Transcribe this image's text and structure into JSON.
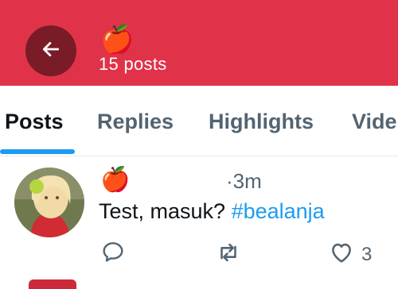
{
  "header": {
    "back_icon": "arrow-left-icon",
    "profile_emoji": "🍎",
    "post_count": "15 posts",
    "background": "#e0334a"
  },
  "tabs": [
    {
      "label": "Posts",
      "active": true
    },
    {
      "label": "Replies",
      "active": false
    },
    {
      "label": "Highlights",
      "active": false
    },
    {
      "label": "Vide",
      "active": false
    }
  ],
  "post": {
    "display_name": "🍎",
    "time": "·3m",
    "text": "Test, masuk? ",
    "hashtag": "#bealanja",
    "actions": {
      "reply_icon": "reply-icon",
      "repost_icon": "repost-icon",
      "like_icon": "heart-icon",
      "like_count": "3"
    }
  },
  "colors": {
    "accent": "#1d9bf0",
    "text_primary": "#0f1419",
    "text_secondary": "#536471"
  }
}
